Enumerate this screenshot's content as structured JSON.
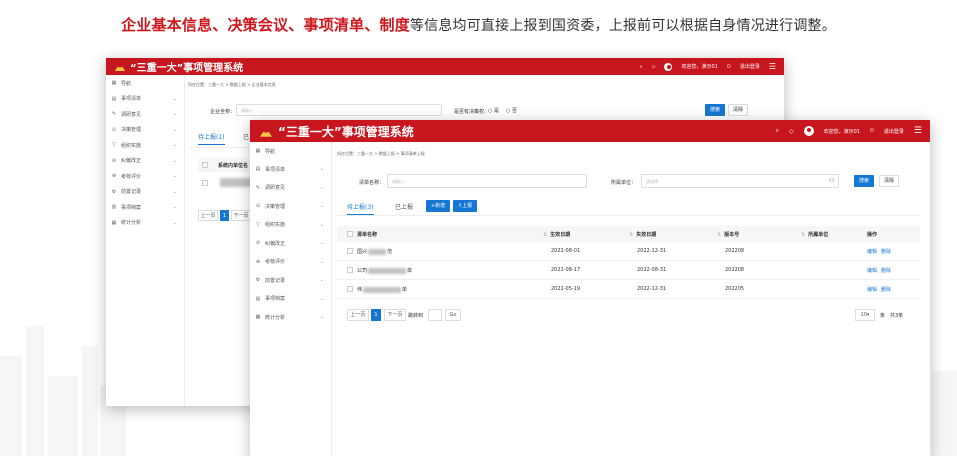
{
  "headline": {
    "parts": [
      {
        "text": "企业基本信息",
        "hl": true
      },
      {
        "text": "、",
        "hl": true
      },
      {
        "text": "决策会议",
        "hl": true
      },
      {
        "text": "、",
        "hl": true
      },
      {
        "text": "事项清单",
        "hl": true
      },
      {
        "text": "、",
        "hl": true
      },
      {
        "text": "制度",
        "hl": true
      },
      {
        "text": "等信息均可直接上报到国资委，上报前可以根据自身情况进行调整。",
        "hl": false
      }
    ]
  },
  "app": {
    "title": "“三重一大”事项管理系统",
    "welcome": "欢迎您，演示01",
    "logout": "退出登录"
  },
  "nav": {
    "header": "导航",
    "items": [
      "事项清单",
      "调研意见",
      "决策管理",
      "组织实施",
      "纠偏改正",
      "考核评价",
      "前置记录",
      "事项档案",
      "统计分析"
    ]
  },
  "back_window": {
    "breadcrumb": "所在位置：三重一大 > 数据上报 > 企业基本信息",
    "company_label": "企业全称：",
    "company_placeholder": "请输入",
    "branch_label": "是否有决策权：",
    "option_yes": "是",
    "option_no": "否",
    "search": "搜索",
    "clear": "清除",
    "tab_pending": "待上报(1)",
    "tab_done": "已",
    "col_unit": "系统内单位名",
    "prev": "上一页",
    "page": "1",
    "next": "下一页"
  },
  "front_window": {
    "breadcrumb": "所在位置：三重一大 > 数据上报 > 事项清单上报",
    "name_label": "清单名称：",
    "name_placeholder": "请输入",
    "unit_label": "所属单位：",
    "unit_placeholder": "请选择",
    "search": "搜索",
    "clear": "清除",
    "tab_pending": "待上报(3)",
    "tab_done": "已上报",
    "add": "+新增",
    "report": "上报",
    "columns": [
      "清单名称",
      "生效日期",
      "失效日期",
      "版本号",
      "所属单位",
      "操作"
    ],
    "rows": [
      {
        "name_a": "国兴",
        "name_b": "范",
        "start": "2022-08-01",
        "end": "2022-12-31",
        "version": "202208",
        "unit": "",
        "edit": "编辑",
        "del": "删除"
      },
      {
        "name_a": "公司",
        "name_b": "单",
        "start": "2022-08-17",
        "end": "2022-08-31",
        "version": "202208",
        "unit": "",
        "edit": "编辑",
        "del": "删除"
      },
      {
        "name_a": "伟",
        "name_b": "单",
        "start": "2022-05-19",
        "end": "2022-12-31",
        "version": "202205",
        "unit": "",
        "edit": "编辑",
        "del": "删除"
      }
    ],
    "prev": "上一页",
    "page": "1",
    "next": "下一页",
    "jump": "跳转到",
    "go": "Go",
    "page_size": "10",
    "per": "条",
    "total": "共3条"
  },
  "colors": {
    "brand": "#c8161e",
    "accent": "#1677d2",
    "headline_red": "#d0161c"
  }
}
